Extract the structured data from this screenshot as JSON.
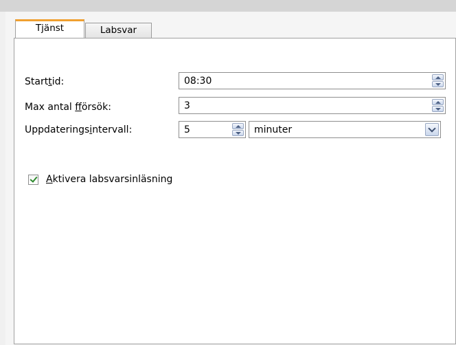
{
  "tabs": [
    {
      "label": "Tjänst",
      "active": true
    },
    {
      "label": "Labsvar",
      "active": false
    }
  ],
  "form": {
    "start_time": {
      "label": "Starttid:",
      "value": "08:30"
    },
    "max_attempts": {
      "label": "Max antal fförsök:",
      "value": "3"
    },
    "update_interval": {
      "label": "Uppdateringsintervall:",
      "value": "5",
      "unit": "minuter"
    }
  },
  "checkbox": {
    "label": "Aktivera labsvarsinläsning",
    "checked": true
  },
  "colors": {
    "active_tab_accent": "#f0a030",
    "check": "#2c8a2c",
    "spin_arrow": "#4d6185"
  },
  "icons": [
    "spin-up-icon",
    "spin-down-icon",
    "chevron-down-icon",
    "checkmark-icon"
  ]
}
